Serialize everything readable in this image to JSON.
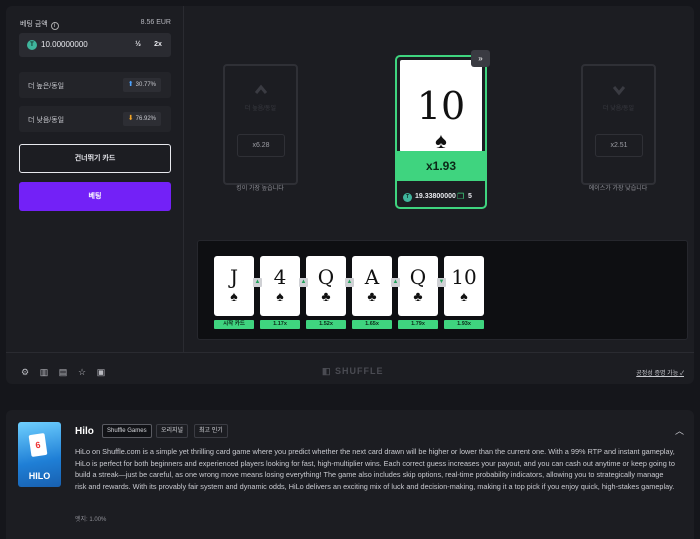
{
  "sidebar": {
    "bet_label": "베팅 금액",
    "balance_eur": "8.56 EUR",
    "bet_value": "10.00000000",
    "half_label": "½",
    "double_label": "2x",
    "higher": {
      "label": "더 높은/동일",
      "pct": "30.77%"
    },
    "lower": {
      "label": "더 낮음/동일",
      "pct": "76.92%"
    },
    "skip_label": "건너뛰기 카드",
    "bet_button": "베팅"
  },
  "table": {
    "left_ghost": {
      "text": "더 높음/동일",
      "mult": "x6.28",
      "caption": "킹이 가장 높습니다"
    },
    "right_ghost": {
      "text": "더 낮음/동일",
      "mult": "x2.51",
      "caption": "에이스가 가장 낮습니다"
    },
    "current_card": {
      "rank": "10",
      "suit": "♠",
      "multiplier": "x1.93",
      "payout": "19.33800000",
      "count": "5"
    },
    "skip_icon": "fast-forward-icon"
  },
  "history": [
    {
      "rank": "J",
      "suit": "♠",
      "label": "시작 카드"
    },
    {
      "rank": "4",
      "suit": "♠",
      "label": "1.17x"
    },
    {
      "rank": "Q",
      "suit": "♣",
      "label": "1.52x"
    },
    {
      "rank": "A",
      "suit": "♣",
      "label": "1.65x"
    },
    {
      "rank": "Q",
      "suit": "♣",
      "label": "1.79x"
    },
    {
      "rank": "10",
      "suit": "♠",
      "label": "1.93x"
    }
  ],
  "footer": {
    "logo": "SHUFFLE",
    "fairness": "공정성 증명 가능"
  },
  "info": {
    "title": "Hilo",
    "tags": [
      "Shuffle Games",
      "오리지널",
      "최고 인기"
    ],
    "description": "HiLo on Shuffle.com is a simple yet thrilling card game where you predict whether the next card drawn will be higher or lower than the current one. With a 99% RTP and instant gameplay, HiLo is perfect for both beginners and experienced players looking for fast, high-multiplier wins. Each correct guess increases your payout, and you can cash out anytime or keep going to build a streak—just be careful, as one wrong move means losing everything! The game also includes skip options, real-time probability indicators, allowing you to strategically manage risk and rewards. With its provably fair system and dynamic odds, HiLo delivers an exciting mix of luck and decision-making, making it a top pick if you enjoy quick, high-stakes gameplay.",
    "edge": "엣지: 1.00%",
    "thumb_title": "HILO",
    "thumb_card": "6"
  },
  "colors": {
    "accent": "#7321f7",
    "win": "#3fd47f",
    "bg": "#15161b",
    "panel": "#1c1d22"
  }
}
